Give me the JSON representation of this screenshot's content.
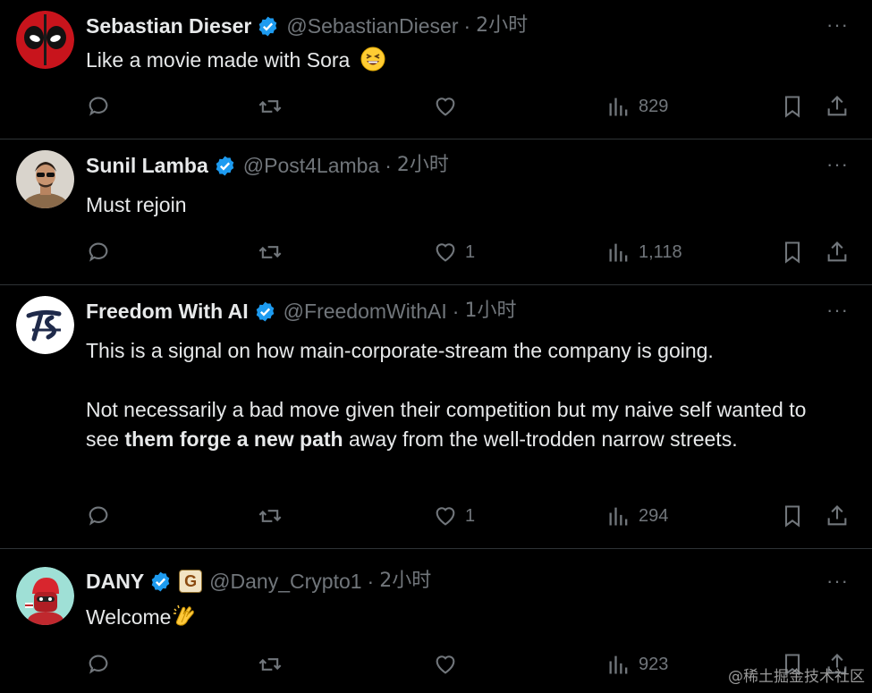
{
  "tweets": [
    {
      "name": "Sebastian Dieser",
      "handle": "@SebastianDieser",
      "time": "2小时",
      "text_paragraphs": [
        "Like a movie made with Sora"
      ],
      "has_emoji": "grinning-squinting-face",
      "reply_count": "",
      "retweet_count": "",
      "like_count": "",
      "view_count": "829"
    },
    {
      "name": "Sunil Lamba",
      "handle": "@Post4Lamba",
      "time": "2小时",
      "text_paragraphs": [
        "Must rejoin"
      ],
      "reply_count": "",
      "retweet_count": "",
      "like_count": "1",
      "view_count": "1,118"
    },
    {
      "name": "Freedom With AI",
      "handle": "@FreedomWithAI",
      "time": "1小时",
      "text_p1": "This is a signal on how main-corporate-stream the company is going.",
      "text_p2_before": "Not necessarily a bad move given their competition but my naive self wanted to see ",
      "text_p2_bold": "them forge a new path",
      "text_p2_after": " away from the well-trodden narrow streets.",
      "reply_count": "",
      "retweet_count": "",
      "like_count": "1",
      "view_count": "294"
    },
    {
      "name": "DANY",
      "handle": "@Dany_Crypto1",
      "time": "2小时",
      "badge_letter": "G",
      "text_paragraphs": [
        "Welcome"
      ],
      "has_emoji": "clapping-hands",
      "reply_count": "",
      "retweet_count": "",
      "like_count": "",
      "view_count": "923"
    }
  ],
  "more_label": "···",
  "watermark": "@稀土掘金技术社区",
  "colors": {
    "background": "#000000",
    "text": "#e7e9ea",
    "muted": "#71767b",
    "verified": "#1d9bf0",
    "divider": "#2f3336"
  }
}
